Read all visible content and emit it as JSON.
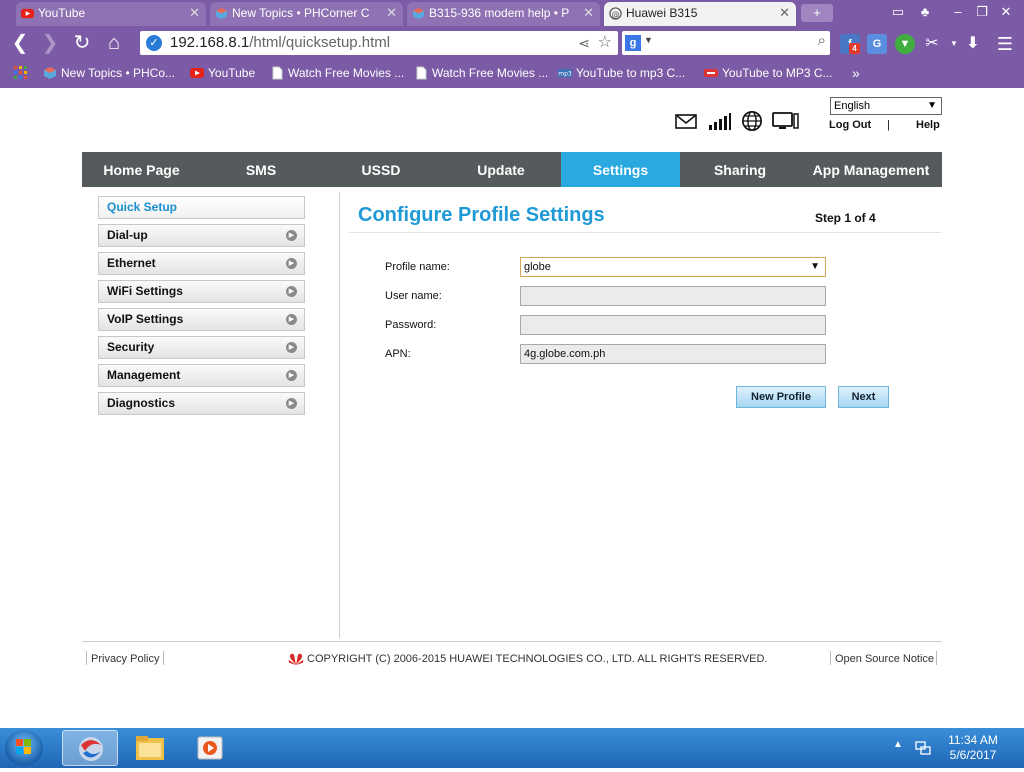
{
  "browser": {
    "tabs": [
      {
        "title": "YouTube",
        "icon": "youtube-icon"
      },
      {
        "title": "New Topics • PHCorner C",
        "icon": "phcorner-icon"
      },
      {
        "title": "B315-936 modem help • P",
        "icon": "phcorner-icon"
      },
      {
        "title": "Huawei B315",
        "icon": "at-icon"
      }
    ],
    "new_tab": "+",
    "url_host": "192.168.8.1",
    "url_path": "/html/quicksetup.html",
    "bookmarks": [
      {
        "label": "New Topics • PHCo...",
        "icon": "phcorner-icon"
      },
      {
        "label": "YouTube",
        "icon": "youtube-icon"
      },
      {
        "label": "Watch Free Movies ...",
        "icon": "page-icon"
      },
      {
        "label": "Watch Free Movies ...",
        "icon": "page-icon"
      },
      {
        "label": "YouTube to mp3 C...",
        "icon": "mp3-icon"
      },
      {
        "label": "YouTube to MP3 C...",
        "icon": "mp3-icon"
      }
    ],
    "more_bookmarks": "»",
    "extension_badge": "4",
    "accent": "#7b5aa6"
  },
  "router": {
    "language": "English",
    "logout": "Log Out",
    "separator": "|",
    "help": "Help",
    "nav": [
      "Home Page",
      "SMS",
      "USSD",
      "Update",
      "Settings",
      "Sharing",
      "App Management"
    ],
    "nav_active": "Settings",
    "sidebar": [
      "Quick Setup",
      "Dial-up",
      "Ethernet",
      "WiFi Settings",
      "VoIP Settings",
      "Security",
      "Management",
      "Diagnostics"
    ],
    "sidebar_active": "Quick Setup",
    "title": "Configure Profile Settings",
    "step": "Step 1 of 4",
    "form": {
      "profile_label": "Profile name:",
      "profile_value": "globe",
      "username_label": "User name:",
      "username_value": "",
      "password_label": "Password:",
      "password_value": "",
      "apn_label": "APN:",
      "apn_value": "4g.globe.com.ph"
    },
    "buttons": {
      "new_profile": "New Profile",
      "next": "Next"
    },
    "footer": {
      "privacy": "Privacy Policy",
      "copyright": "COPYRIGHT (C) 2006-2015 HUAWEI TECHNOLOGIES CO., LTD. ALL RIGHTS RESERVED.",
      "open_source": "Open Source Notice"
    },
    "colors": {
      "accent": "#2aa9e0",
      "nav_bg": "#555b5c",
      "title": "#1f9ad6"
    }
  },
  "taskbar": {
    "time": "11:34 AM",
    "date": "5/6/2017"
  }
}
